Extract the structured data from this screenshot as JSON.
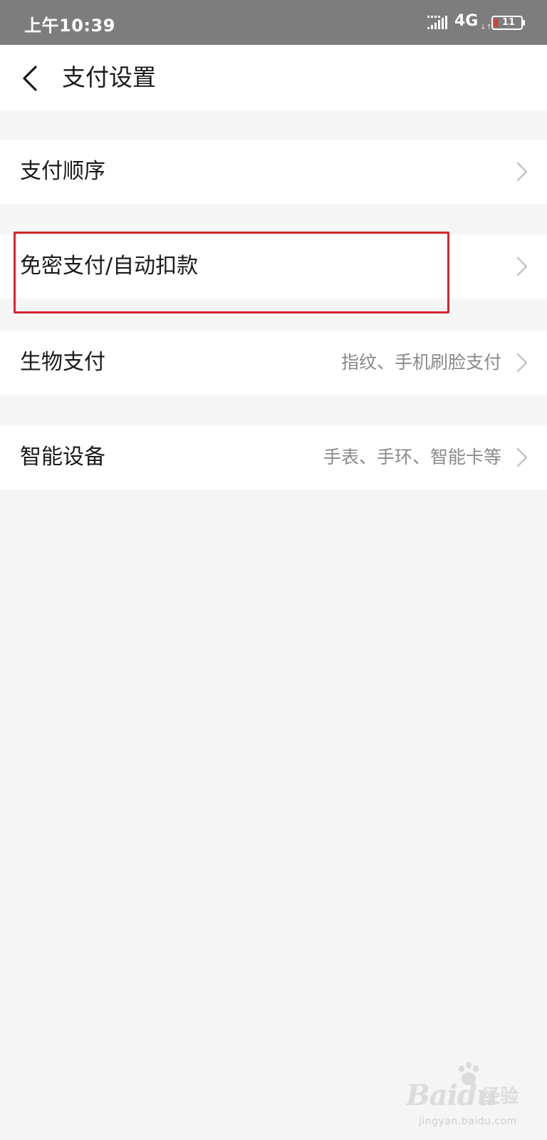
{
  "status_bar": {
    "time": "上午10:39",
    "network": "4G",
    "network_arrows": "↓↑",
    "battery_level": "11",
    "icons": [
      "signal-icon",
      "battery-icon"
    ]
  },
  "nav": {
    "title": "支付设置",
    "back_icon": "back-arrow-icon"
  },
  "settings": [
    {
      "label": "支付顺序",
      "value": ""
    },
    {
      "label": "免密支付/自动扣款",
      "value": ""
    },
    {
      "label": "生物支付",
      "value": "指纹、手机刷脸支付"
    },
    {
      "label": "智能设备",
      "value": "手表、手环、智能卡等"
    }
  ],
  "highlight": {
    "color": "#d6242e",
    "target": "免密支付/自动扣款"
  },
  "watermark": {
    "brand": "Bai",
    "brand_suffix": "du",
    "product": "经验",
    "url": "jingyan.baidu.com"
  },
  "colors": {
    "status_bar_bg": "#7d7d7d",
    "page_bg": "#f5f5f5",
    "row_bg": "#ffffff",
    "text_primary": "#1a1a1a",
    "text_secondary": "#8a8a8a",
    "battery_low": "#e53935"
  }
}
